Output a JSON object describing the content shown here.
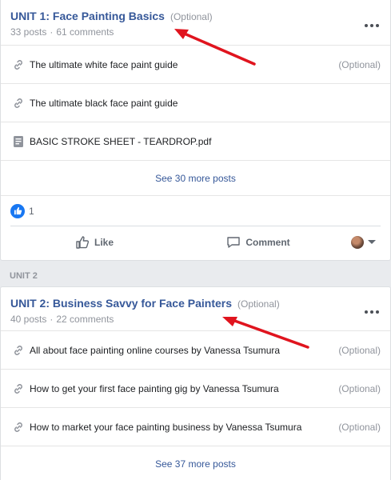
{
  "units": [
    {
      "title": "UNIT 1: Face Painting Basics",
      "optional": "(Optional)",
      "posts": "33 posts",
      "comments": "61 comments",
      "items": [
        {
          "icon": "link-icon",
          "title": "The ultimate white face paint guide",
          "optional": "(Optional)"
        },
        {
          "icon": "link-icon",
          "title": "The ultimate black face paint guide",
          "optional": ""
        },
        {
          "icon": "file-icon",
          "title": "BASIC STROKE SHEET - TEARDROP.pdf",
          "optional": ""
        }
      ],
      "see_more": "See 30 more posts",
      "like_count": "1",
      "actions": {
        "like": "Like",
        "comment": "Comment"
      }
    },
    {
      "section_label": "UNIT 2",
      "title": "UNIT 2: Business Savvy for Face Painters",
      "optional": "(Optional)",
      "posts": "40 posts",
      "comments": "22 comments",
      "items": [
        {
          "icon": "link-icon",
          "title": "All about face painting online courses by Vanessa Tsumura",
          "optional": "(Optional)"
        },
        {
          "icon": "link-icon",
          "title": "How to get your first face painting gig by Vanessa Tsumura",
          "optional": "(Optional)"
        },
        {
          "icon": "link-icon",
          "title": "How to market your face painting business by Vanessa Tsumura",
          "optional": "(Optional)"
        }
      ],
      "see_more": "See 37 more posts"
    }
  ],
  "colors": {
    "link": "#365899",
    "muted": "#90949c",
    "accent_arrow": "#e0141e",
    "like_blue": "#1877f2"
  },
  "icons": [
    "link-icon",
    "file-icon",
    "like-icon",
    "comment-icon",
    "more-icon",
    "chevron-down-icon"
  ]
}
